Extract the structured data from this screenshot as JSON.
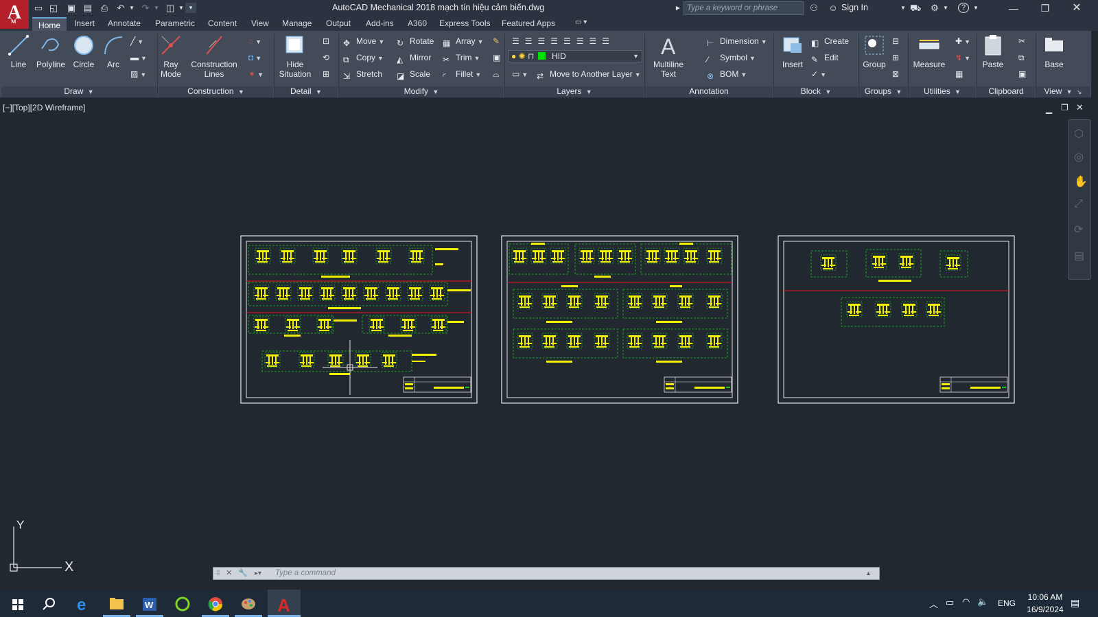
{
  "titlebar": {
    "logo_letter": "A",
    "logo_sub": "M",
    "document_title": "AutoCAD Mechanical 2018    mạch tín hiệu cảm biến.dwg",
    "search_placeholder": "Type a keyword or phrase",
    "signin_label": "Sign In"
  },
  "tabs": [
    "Home",
    "Insert",
    "Annotate",
    "Parametric",
    "Content",
    "View",
    "Manage",
    "Output",
    "Add-ins",
    "A360",
    "Express Tools",
    "Featured Apps"
  ],
  "ribbon": {
    "draw": {
      "label": "Draw",
      "line": "Line",
      "polyline": "Polyline",
      "circle": "Circle",
      "arc": "Arc"
    },
    "construction": {
      "label": "Construction",
      "ray_mode_1": "Ray",
      "ray_mode_2": "Mode",
      "construction_lines_1": "Construction",
      "construction_lines_2": "Lines"
    },
    "detail": {
      "label": "Detail",
      "hide_1": "Hide",
      "hide_2": "Situation"
    },
    "modify": {
      "label": "Modify",
      "move": "Move",
      "rotate": "Rotate",
      "array": "Array",
      "copy": "Copy",
      "mirror": "Mirror",
      "trim": "Trim",
      "stretch": "Stretch",
      "scale": "Scale",
      "fillet": "Fillet"
    },
    "layers": {
      "label": "Layers",
      "current_layer": "HID",
      "move_to_layer": "Move to Another Layer"
    },
    "annotation": {
      "label": "Annotation",
      "multiline_1": "Multiline",
      "multiline_2": "Text",
      "dimension": "Dimension",
      "symbol": "Symbol",
      "bom": "BOM"
    },
    "block": {
      "label": "Block",
      "insert": "Insert",
      "create": "Create",
      "edit": "Edit"
    },
    "groups": {
      "label": "Groups",
      "group": "Group"
    },
    "utilities": {
      "label": "Utilities",
      "measure": "Measure"
    },
    "clipboard": {
      "label": "Clipboard",
      "paste": "Paste"
    },
    "view": {
      "label": "View",
      "base": "Base"
    }
  },
  "canvas": {
    "viewport_label": "[−][Top][2D Wireframe]",
    "command_placeholder": "Type a command",
    "ucs_y": "Y",
    "ucs_x": "X"
  },
  "taskbar": {
    "language": "ENG",
    "time": "10:06 AM",
    "date": "16/9/2024"
  },
  "colors": {
    "drawing_yellow": "#f2f200",
    "drawing_green": "#19c419",
    "drawing_red": "#c8161e",
    "sheet_border": "#e8e8e8",
    "layer_swatch": "#00e000",
    "autocad_red": "#b3202a"
  }
}
